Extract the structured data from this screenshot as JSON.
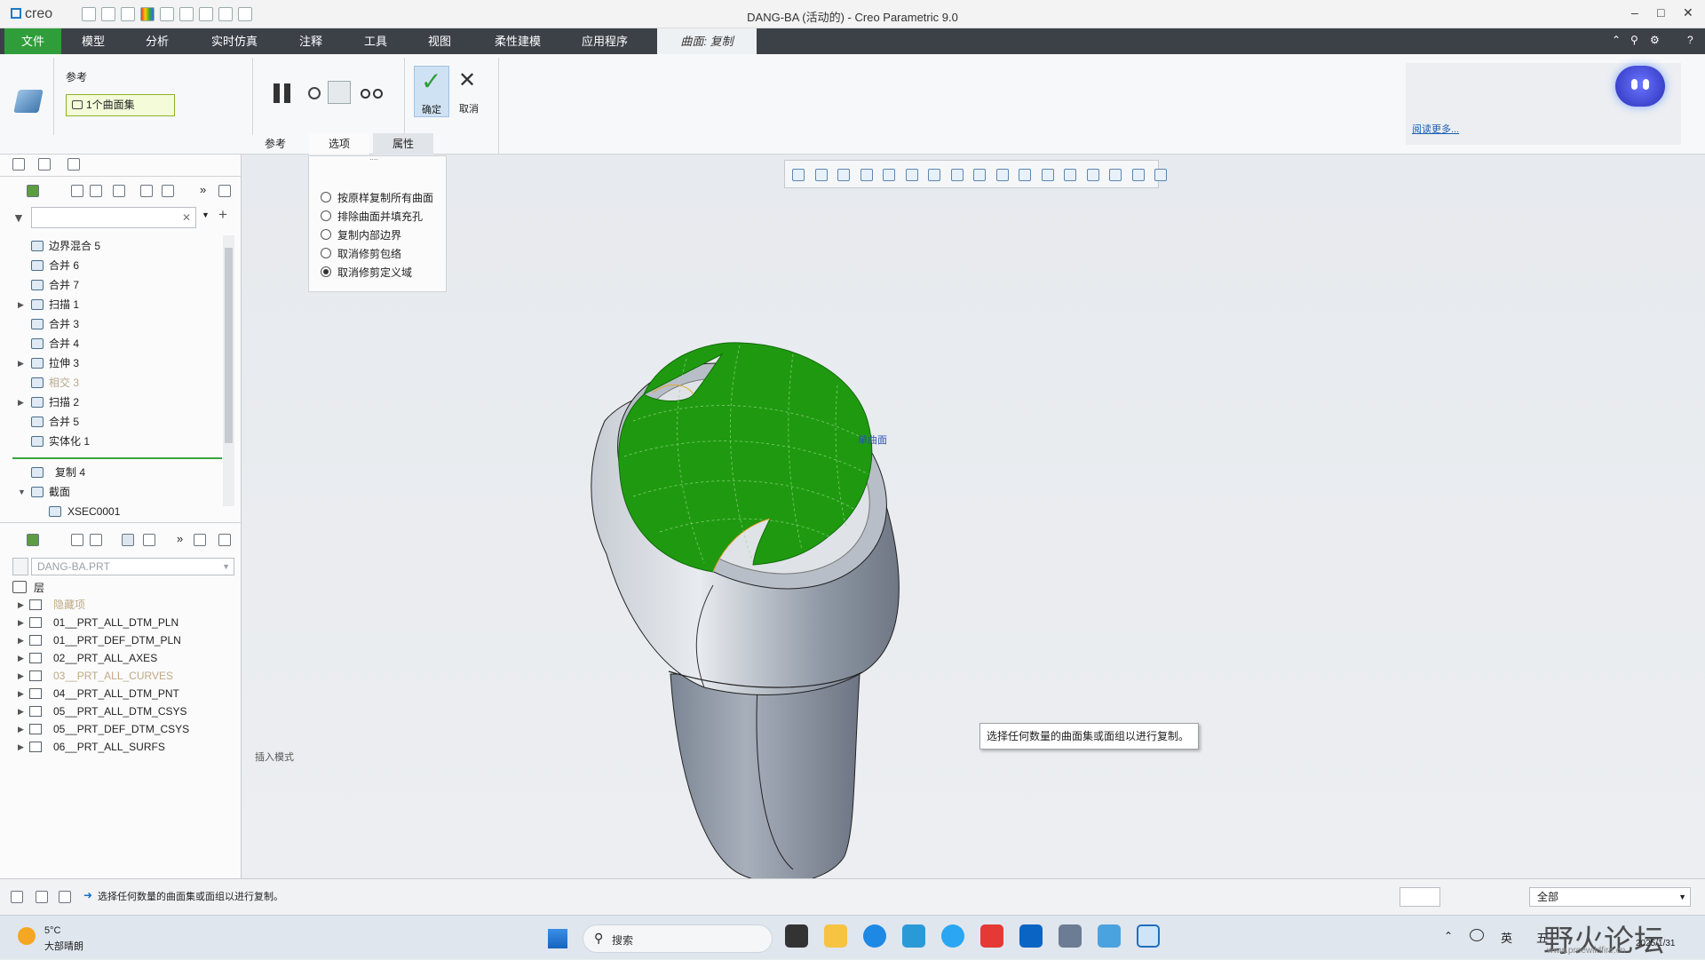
{
  "app": {
    "logo": "creo",
    "title": "DANG-BA (活动的) - Creo Parametric 9.0"
  },
  "menu": {
    "tabs": [
      "文件",
      "模型",
      "分析",
      "实时仿真",
      "注释",
      "工具",
      "视图",
      "柔性建模",
      "应用程序",
      "曲面: 复制"
    ],
    "active_tab": "曲面: 复制"
  },
  "ribbon": {
    "ref_label": "参考",
    "ref_chip": "1个曲面集",
    "ok_label": "确定",
    "cancel_label": "取消",
    "subtabs": [
      "参考",
      "选项",
      "属性"
    ],
    "selected_subtab": "选项",
    "read_more": "阅读更多..."
  },
  "options": {
    "grip": "....",
    "items": [
      {
        "label": "按原样复制所有曲面",
        "checked": false
      },
      {
        "label": "排除曲面并填充孔",
        "checked": false
      },
      {
        "label": "复制内部边界",
        "checked": false
      },
      {
        "label": "取消修剪包络",
        "checked": false
      },
      {
        "label": "取消修剪定义域",
        "checked": true
      }
    ]
  },
  "model_tree": {
    "search_placeholder": "",
    "items": [
      {
        "label": "边界混合 5",
        "expandable": false,
        "dim": false
      },
      {
        "label": "合并 6",
        "expandable": false,
        "dim": false
      },
      {
        "label": "合并 7",
        "expandable": false,
        "dim": false
      },
      {
        "label": "扫描 1",
        "expandable": true,
        "dim": false
      },
      {
        "label": "合并 3",
        "expandable": false,
        "dim": false
      },
      {
        "label": "合并 4",
        "expandable": false,
        "dim": false
      },
      {
        "label": "拉伸 3",
        "expandable": true,
        "dim": false
      },
      {
        "label": "相交 3",
        "expandable": false,
        "dim": true
      },
      {
        "label": "扫描 2",
        "expandable": true,
        "dim": false
      },
      {
        "label": "合并 5",
        "expandable": false,
        "dim": false
      },
      {
        "label": "实体化 1",
        "expandable": false,
        "dim": false
      }
    ],
    "after_insert": [
      {
        "label": "复制 4",
        "expandable": false
      },
      {
        "label": "截面",
        "expandable": true
      },
      {
        "label": "XSEC0001",
        "expandable": false
      }
    ]
  },
  "layers": {
    "part": "DANG-BA.PRT",
    "header": "层",
    "items": [
      {
        "label": "隐藏项",
        "dim": true
      },
      {
        "label": "01__PRT_ALL_DTM_PLN",
        "dim": false
      },
      {
        "label": "01__PRT_DEF_DTM_PLN",
        "dim": false
      },
      {
        "label": "02__PRT_ALL_AXES",
        "dim": false
      },
      {
        "label": "03__PRT_ALL_CURVES",
        "dim": true
      },
      {
        "label": "04__PRT_ALL_DTM_PNT",
        "dim": false
      },
      {
        "label": "05__PRT_ALL_DTM_CSYS",
        "dim": false
      },
      {
        "label": "05__PRT_DEF_DTM_CSYS",
        "dim": false
      },
      {
        "label": "06__PRT_ALL_SURFS",
        "dim": false
      }
    ]
  },
  "graphics": {
    "insert_mode": "插入模式",
    "surface_label": "单曲面",
    "tooltip": "选择任何数量的曲面集或面组以进行复制。",
    "surface_color": "#1f9a10",
    "body_color": "#8e97a5"
  },
  "status": {
    "message": "选择任何数量的曲面集或面组以进行复制。",
    "filter": "全部"
  },
  "taskbar": {
    "weather_temp": "5°C",
    "weather_desc": "大部晴朗",
    "search_placeholder": "搜索",
    "ime": "英",
    "ime2": "五",
    "date": "2025/1/31",
    "watermark": "野火论坛",
    "watermark_url": "www.proewildfire.cn"
  }
}
